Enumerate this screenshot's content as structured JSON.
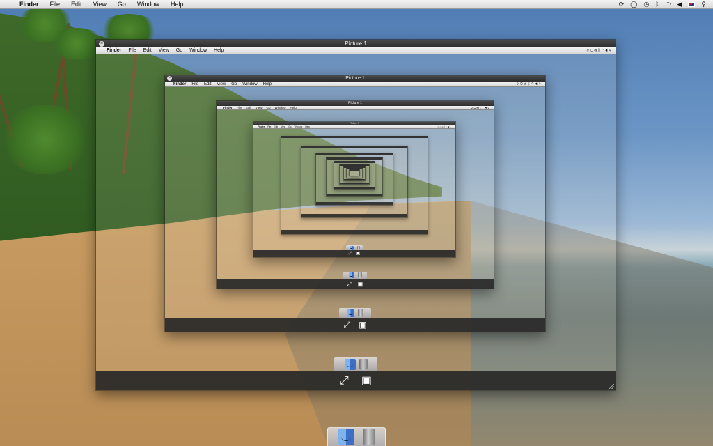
{
  "menubar": {
    "app_name": "Finder",
    "items": [
      "File",
      "Edit",
      "View",
      "Go",
      "Window",
      "Help"
    ],
    "status_icons": [
      "sync-icon",
      "chat-icon",
      "clock-icon",
      "bluetooth-icon",
      "wifi-icon",
      "volume-icon",
      "australia-flag-icon",
      "spotlight-icon"
    ]
  },
  "preview_window": {
    "title": "Picture 1",
    "menubar": {
      "app_name": "Finder",
      "items": [
        "File",
        "Edit",
        "View",
        "Go",
        "Window",
        "Help"
      ]
    },
    "toolbar": {
      "fullscreen_icon": "expand-arrows-icon",
      "slideshow_icon": "index-sheet-icon"
    }
  },
  "dock": {
    "items": [
      "finder-icon",
      "trash-icon"
    ]
  }
}
